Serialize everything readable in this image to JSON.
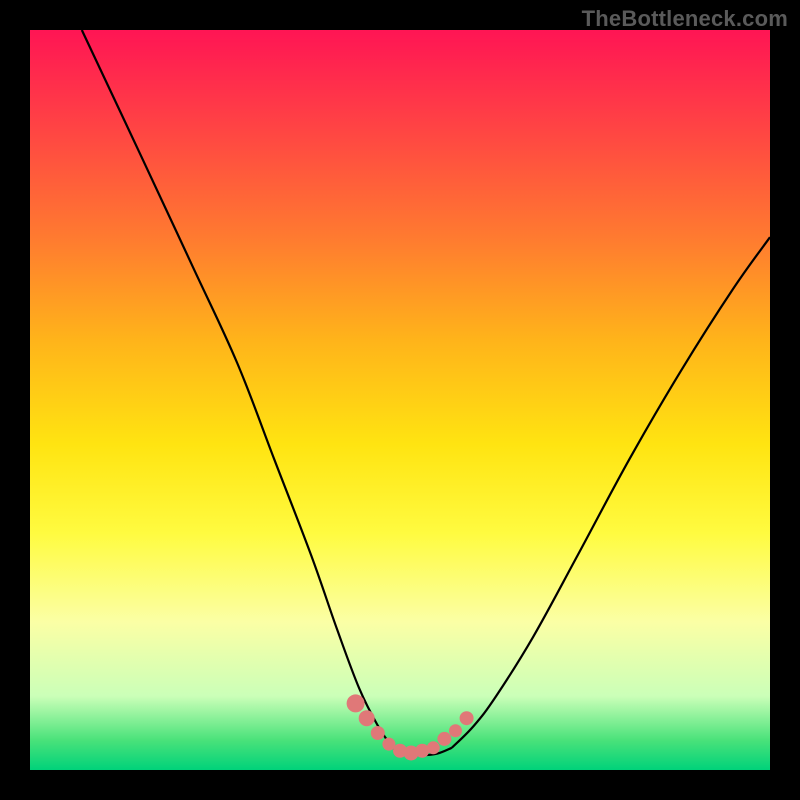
{
  "attribution": "TheBottleneck.com",
  "chart_data": {
    "type": "line",
    "title": "",
    "xlabel": "",
    "ylabel": "",
    "xlim": [
      0,
      100
    ],
    "ylim": [
      0,
      100
    ],
    "series": [
      {
        "name": "left-descent-curve",
        "x": [
          7,
          15,
          22,
          28,
          33,
          38,
          41.5,
          44.5,
          47,
          49
        ],
        "values": [
          100,
          83,
          68,
          55,
          42,
          29,
          19,
          11,
          6,
          3
        ]
      },
      {
        "name": "right-ascent-curve",
        "x": [
          57,
          60,
          63,
          68,
          74,
          81,
          88,
          95,
          100
        ],
        "values": [
          3,
          6,
          10,
          18,
          29,
          42,
          54,
          65,
          72
        ]
      },
      {
        "name": "valley-floor",
        "x": [
          49,
          51,
          53,
          55,
          57
        ],
        "values": [
          3,
          2.2,
          2,
          2.2,
          3
        ]
      }
    ],
    "markers": [
      {
        "name": "valley-marker-pink",
        "color": "#e07878",
        "x": [
          44,
          45.5,
          47,
          48.5,
          50,
          51.5,
          53,
          54.5,
          56,
          57.5,
          59
        ],
        "values": [
          9,
          7,
          5,
          3.5,
          2.6,
          2.3,
          2.6,
          3,
          4.2,
          5.3,
          7
        ],
        "size": [
          18,
          16,
          14,
          13,
          14,
          15,
          14,
          13,
          14,
          13,
          14
        ]
      }
    ],
    "grid": false,
    "legend": false
  }
}
